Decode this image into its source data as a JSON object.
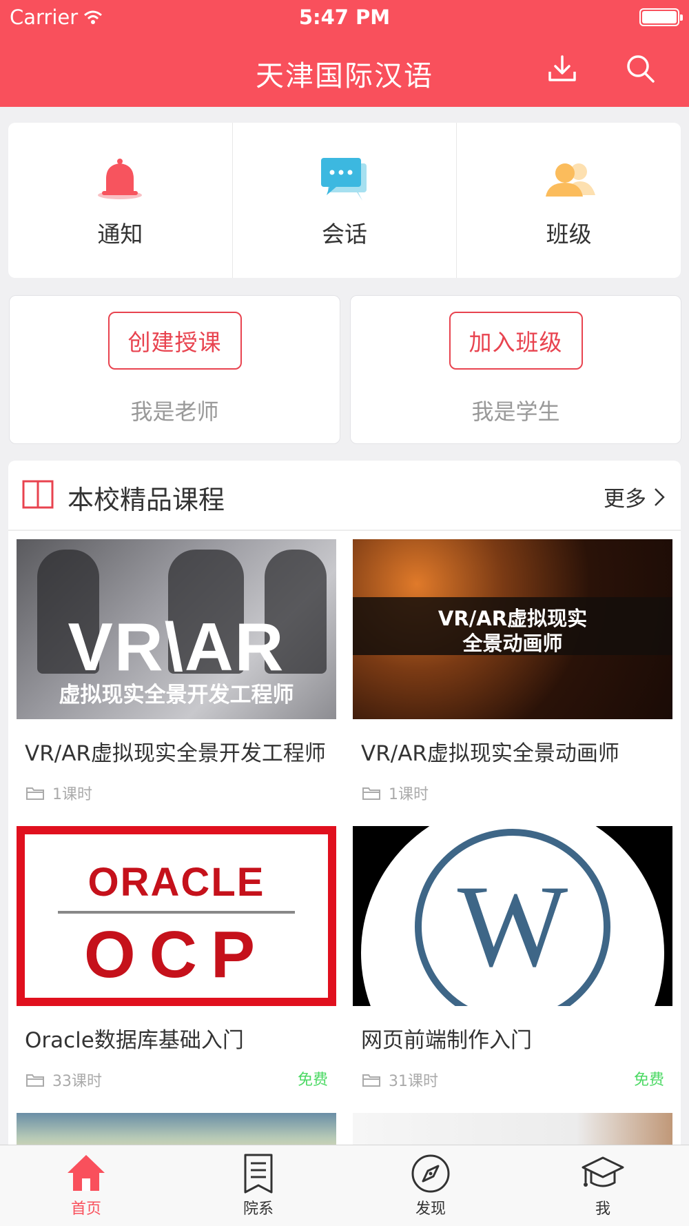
{
  "status_bar": {
    "carrier": "Carrier",
    "time": "5:47 PM"
  },
  "header": {
    "title": "天津国际汉语"
  },
  "quick_actions": [
    {
      "label": "通知",
      "icon": "bell-icon"
    },
    {
      "label": "会话",
      "icon": "chat-bubbles-icon"
    },
    {
      "label": "班级",
      "icon": "people-icon"
    }
  ],
  "roles": {
    "teacher": {
      "button": "创建授课",
      "subtitle": "我是老师"
    },
    "student": {
      "button": "加入班级",
      "subtitle": "我是学生"
    }
  },
  "courses_section": {
    "title": "本校精品课程",
    "more": "更多",
    "items": [
      {
        "title": "VR/AR虚拟现实全景开发工程师",
        "lessons": "1课时",
        "price": "",
        "thumb_big": "VR\\AR",
        "thumb_sub": "虚拟现实全景开发工程师"
      },
      {
        "title": "VR/AR虚拟现实全景动画师",
        "lessons": "1课时",
        "price": "",
        "thumb_l1": "VR/AR虚拟现实",
        "thumb_l2": "全景动画师"
      },
      {
        "title": "Oracle数据库基础入门",
        "lessons": "33课时",
        "price": "免费",
        "thumb_l1": "ORACLE",
        "thumb_l2": "OCP"
      },
      {
        "title": "网页前端制作入门",
        "lessons": "31课时",
        "price": "免费",
        "thumb_l1": "W"
      }
    ]
  },
  "tabbar": [
    {
      "label": "首页",
      "icon": "home-icon",
      "active": true
    },
    {
      "label": "院系",
      "icon": "document-icon",
      "active": false
    },
    {
      "label": "发现",
      "icon": "compass-icon",
      "active": false
    },
    {
      "label": "我",
      "icon": "graduation-cap-icon",
      "active": false
    }
  ],
  "colors": {
    "brand": "#f9505c",
    "button_border": "#e8434f",
    "free": "#4cd964"
  }
}
